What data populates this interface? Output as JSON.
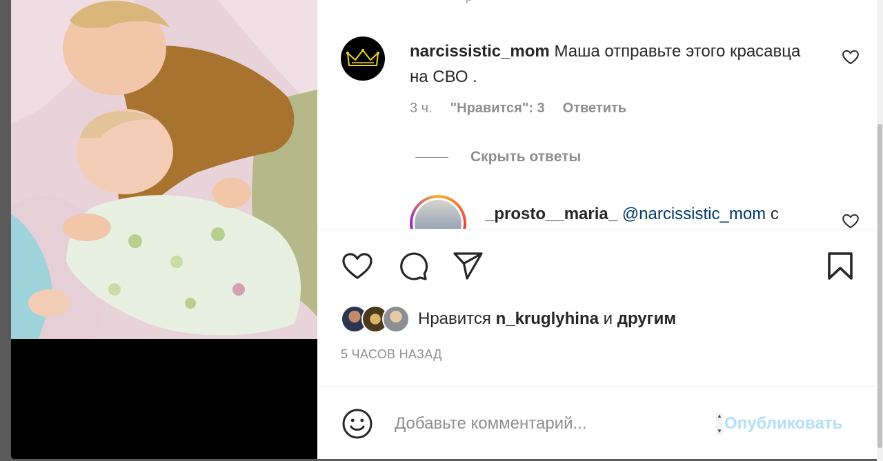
{
  "colors": {
    "text": "#262626",
    "secondary": "#8e8e8e",
    "mention": "#00376b",
    "publish_disabled": "#b2dffc"
  },
  "comment": {
    "username": "narcissistic_mom",
    "text": "Маша отправьте этого красавца на СВО .",
    "time": "3 ч.",
    "likes": "\"Нравится\": 3",
    "reply_label": "Ответить",
    "avatar_icon": "crown-icon"
  },
  "hide_replies_label": "Скрыть ответы",
  "reply": {
    "username": "_prosto__maria_",
    "mention": "@narcissistic_mom",
    "text_start": "с"
  },
  "actions": {
    "like_icon": "heart-icon",
    "comment_icon": "comment-icon",
    "share_icon": "send-icon",
    "save_icon": "bookmark-icon"
  },
  "likes": {
    "prefix": "Нравится",
    "user": "n_kruglyhina",
    "and": "и",
    "others": "другим"
  },
  "time_ago": "5 ЧАСОВ НАЗАД",
  "comment_box": {
    "placeholder": "Добавьте комментарий...",
    "publish_label": "Опубликовать",
    "emoji_icon": "smiley-icon"
  }
}
